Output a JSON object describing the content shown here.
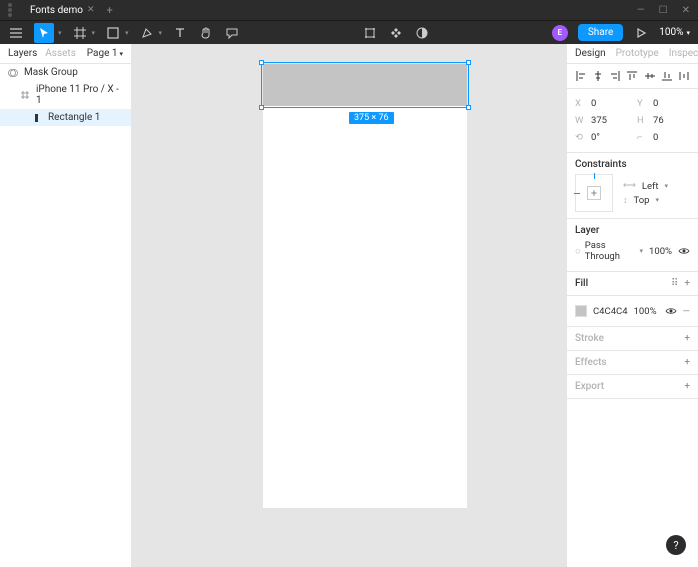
{
  "titlebar": {
    "filename": "Fonts demo"
  },
  "toolbar": {
    "share_label": "Share",
    "zoom": "100%"
  },
  "left": {
    "tab_layers": "Layers",
    "tab_assets": "Assets",
    "page_label": "Page 1",
    "layers": [
      {
        "name": "Mask Group"
      },
      {
        "name": "iPhone 11 Pro / X - 1"
      },
      {
        "name": "Rectangle 1"
      }
    ]
  },
  "canvas": {
    "dim_badge": "375 × 76"
  },
  "design": {
    "tab_design": "Design",
    "tab_prototype": "Prototype",
    "tab_inspect": "Inspect",
    "x_label": "X",
    "x_val": "0",
    "y_label": "Y",
    "y_val": "0",
    "w_label": "W",
    "w_val": "375",
    "h_label": "H",
    "h_val": "76",
    "rot_val": "0°",
    "radius_val": "0",
    "constraints_title": "Constraints",
    "constraint_h": "Left",
    "constraint_v": "Top",
    "layer_title": "Layer",
    "blend": "Pass Through",
    "opacity": "100%",
    "fill_title": "Fill",
    "fill_hex": "C4C4C4",
    "fill_opacity": "100%",
    "stroke_title": "Stroke",
    "effects_title": "Effects",
    "export_title": "Export"
  }
}
